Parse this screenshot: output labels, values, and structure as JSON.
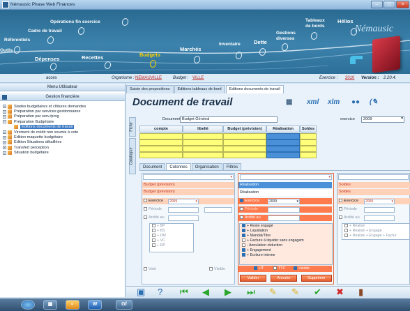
{
  "window": {
    "title": "Némausic Phase Web Finances"
  },
  "nav": {
    "items": [
      "Opérations fin exercice",
      "Cadre de travail",
      "Référentiels",
      "Outils",
      "Dépenses",
      "Recettes",
      "Budgets",
      "Marchés",
      "Inventaire",
      "Dette",
      "Gestions diverses",
      "Tableaux de bords",
      "Hélios"
    ],
    "active": "Budgets",
    "brand": "Némausic"
  },
  "info": {
    "user": "acces",
    "organisme_label": "Organisme :",
    "organisme_value": "NEMAUVILLE",
    "budget_label": "Budget :",
    "budget_value": "VILLE",
    "exercice_label": "Exercice :",
    "exercice_value": "2010",
    "version_label": "Version :",
    "version_value": "2.20.4."
  },
  "left": {
    "menu_header": "Menu Utilisateur",
    "section_header": "Gestion financière",
    "tree": [
      {
        "label": "Stades budgétaires et clôtures demandes",
        "level": 0
      },
      {
        "label": "Préparation par services gestionnaires",
        "level": 0
      },
      {
        "label": "Préparation par serv./prog",
        "level": 0
      },
      {
        "label": "Préparation Budgétaire",
        "level": 0
      },
      {
        "label": "Editions documents de travail",
        "level": 1,
        "selected": true
      },
      {
        "label": "Virement de crédit non soumis à vote",
        "level": 0
      },
      {
        "label": "Edition maquette budgétaire",
        "level": 0
      },
      {
        "label": "Edition Situations détaillées",
        "level": 0
      },
      {
        "label": "Transfert perception",
        "level": 0
      },
      {
        "label": "Situation budgétaire",
        "level": 0
      }
    ]
  },
  "tabs": [
    "Saisie des propositions",
    "Editions tableaux de bord",
    "Editions documents de travail"
  ],
  "main": {
    "title": "Document de travail",
    "document_label": "Document",
    "document_value": "Budget Général",
    "exercice_label": "exercice",
    "exercice_value": "2009",
    "fiche": "Fiche",
    "catalogue": "Catalogue",
    "grid_headers": [
      "compte",
      "libellé",
      "Budget (prévision)",
      "Réalisation",
      "Soldes"
    ]
  },
  "subtabs": [
    "Document",
    "Colonnes",
    "Organisation",
    "Filtres"
  ],
  "columns": {
    "col1": {
      "field1": "Budget (prévision)",
      "field2": "Budget (prévision)",
      "exercice_label": "Exercice",
      "exercice_value": "2009",
      "periode_label": "Période",
      "arrete_label": "Arrêté au",
      "list": [
        "+ BP",
        "+ BS",
        "+ DM",
        "+ VC",
        "+ RP"
      ],
      "vote_label": "Voté",
      "visible_label": "Visible"
    },
    "col2": {
      "field1": "Réalisation",
      "field2": "Réalisation",
      "exercice_label": "Exercice",
      "exercice_value": "2009",
      "periode_label": "Période",
      "arrete_label": "Arrêté au",
      "list": [
        "+ Reste engagé",
        "+ Liquidation",
        "+ Mandat/Titre",
        "+ Facture à liquider sans engagem",
        "- Annulation réduction",
        "+ Engagement",
        "+ Ecriture interne"
      ],
      "ht_label": "HT",
      "ttc_label": "TTC",
      "visible_label": "Visible",
      "valider": "Valider",
      "annuler": "Annuler",
      "supprimer": "Supprimer"
    },
    "col3": {
      "field1": "Soldes",
      "field2": "Soldes",
      "exercice_label": "Exercice",
      "exercice_value": "2009",
      "periode_label": "Période",
      "arrete_label": "Arrêté au",
      "list": [
        "+ Réalisé",
        "+ Réalisé + Engagé",
        "+ Réalisé + Engagé + Factur"
      ]
    }
  },
  "taskbar": {
    "gf": "Gf",
    "w": "W"
  }
}
